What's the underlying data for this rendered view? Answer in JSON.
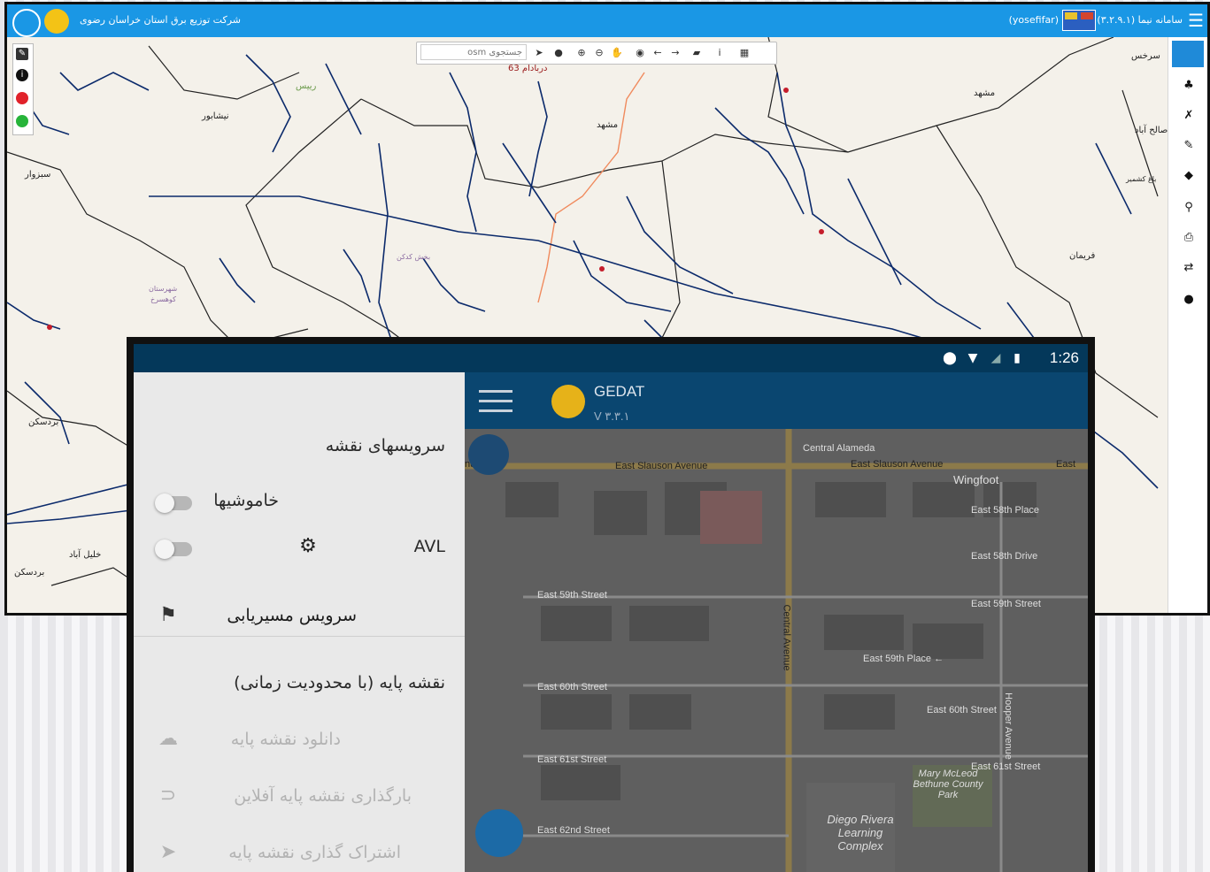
{
  "gis": {
    "company_name": "شرکت توزیع برق استان خراسان رضوی",
    "system_title": "سامانه نیما (۳.۲.۹.۱)",
    "user": "(yosefifar)",
    "search_placeholder": "جستجوی osm",
    "colors": {
      "topbar": "#1a97e5",
      "network_lines": "#0b2a6b",
      "map_bg": "#f4f1ea"
    },
    "right_rail_icons": [
      "layers-icon",
      "hierarchy-icon",
      "measure-icon",
      "brush-icon",
      "tags-icon",
      "search-icon",
      "print-icon",
      "shuffle-icon",
      "comment-icon"
    ],
    "toolbar_icons": [
      "grid-icon",
      "info-icon",
      "eraser-icon",
      "arrow-forward-icon",
      "arrow-back-icon",
      "globe-icon",
      "pan-hand-icon",
      "zoom-out-icon",
      "zoom-in-icon",
      "comment-icon",
      "pointer-icon"
    ],
    "map_labels": {
      "sarakhs": "سرخس",
      "mashhad1": "مشهد",
      "mashhad2": "مشهد",
      "neyshabur": "نیشابور",
      "sabzevar": "سبزوار",
      "bardaskan": "بردسکن",
      "fariman": "فریمان",
      "saleh_abad": "صالح آباد",
      "bagh_keshmir": "باغ کشمیر",
      "khalil_abad": "خلیل آباد",
      "bardaskan2": "بردسکن",
      "reeis": "رییس",
      "d63": "دربادام 63",
      "shahrestan": "شهرستان",
      "koohsorkh": "کوهسرخ",
      "bakhsh": "بخش کدکن"
    }
  },
  "phone": {
    "clock": "1:26",
    "app_title": "GEDAT",
    "app_version": "V ۳.۳.۱",
    "drawer": {
      "header": "سرویسهای نقشه",
      "outages": "خاموشیها",
      "avl": "AVL",
      "routing": "سرویس مسیریابی",
      "basemap_title": "نقشه پایه (با محدودیت زمانی)",
      "download": "دانلود نقشه پایه",
      "upload_offline": "بارگذاری نقشه پایه آفلاین",
      "share": "اشتراک گذاری نقشه پایه"
    },
    "streets": {
      "s1": "East Slauson Avenue",
      "s2": "East Slauson Avenue",
      "s3": "Central Alameda",
      "s4": "Wingfoot",
      "s5": "East 58th Place",
      "s6": "East 58th Drive",
      "s7": "East 59th Street",
      "s8": "East 59th Street",
      "s9": "East 59th Place ←",
      "s10": "East 60th Street",
      "s11": "East 60th Street",
      "s12": "East 61st Street",
      "s13": "East 61st Street",
      "s14": "East 62nd Street",
      "s15": "Central Avenue",
      "s16": "Hooper Avenue",
      "s17": "Mary McLeod Bethune County Park",
      "s18": "Diego Rivera Learning Complex",
      "s19": "East",
      "s20": "nue"
    },
    "colors": {
      "status_bar": "#04385a",
      "app_bar": "#0a4670",
      "drawer_bg": "#e9e9e9",
      "fab": "#1c6aa6"
    }
  }
}
